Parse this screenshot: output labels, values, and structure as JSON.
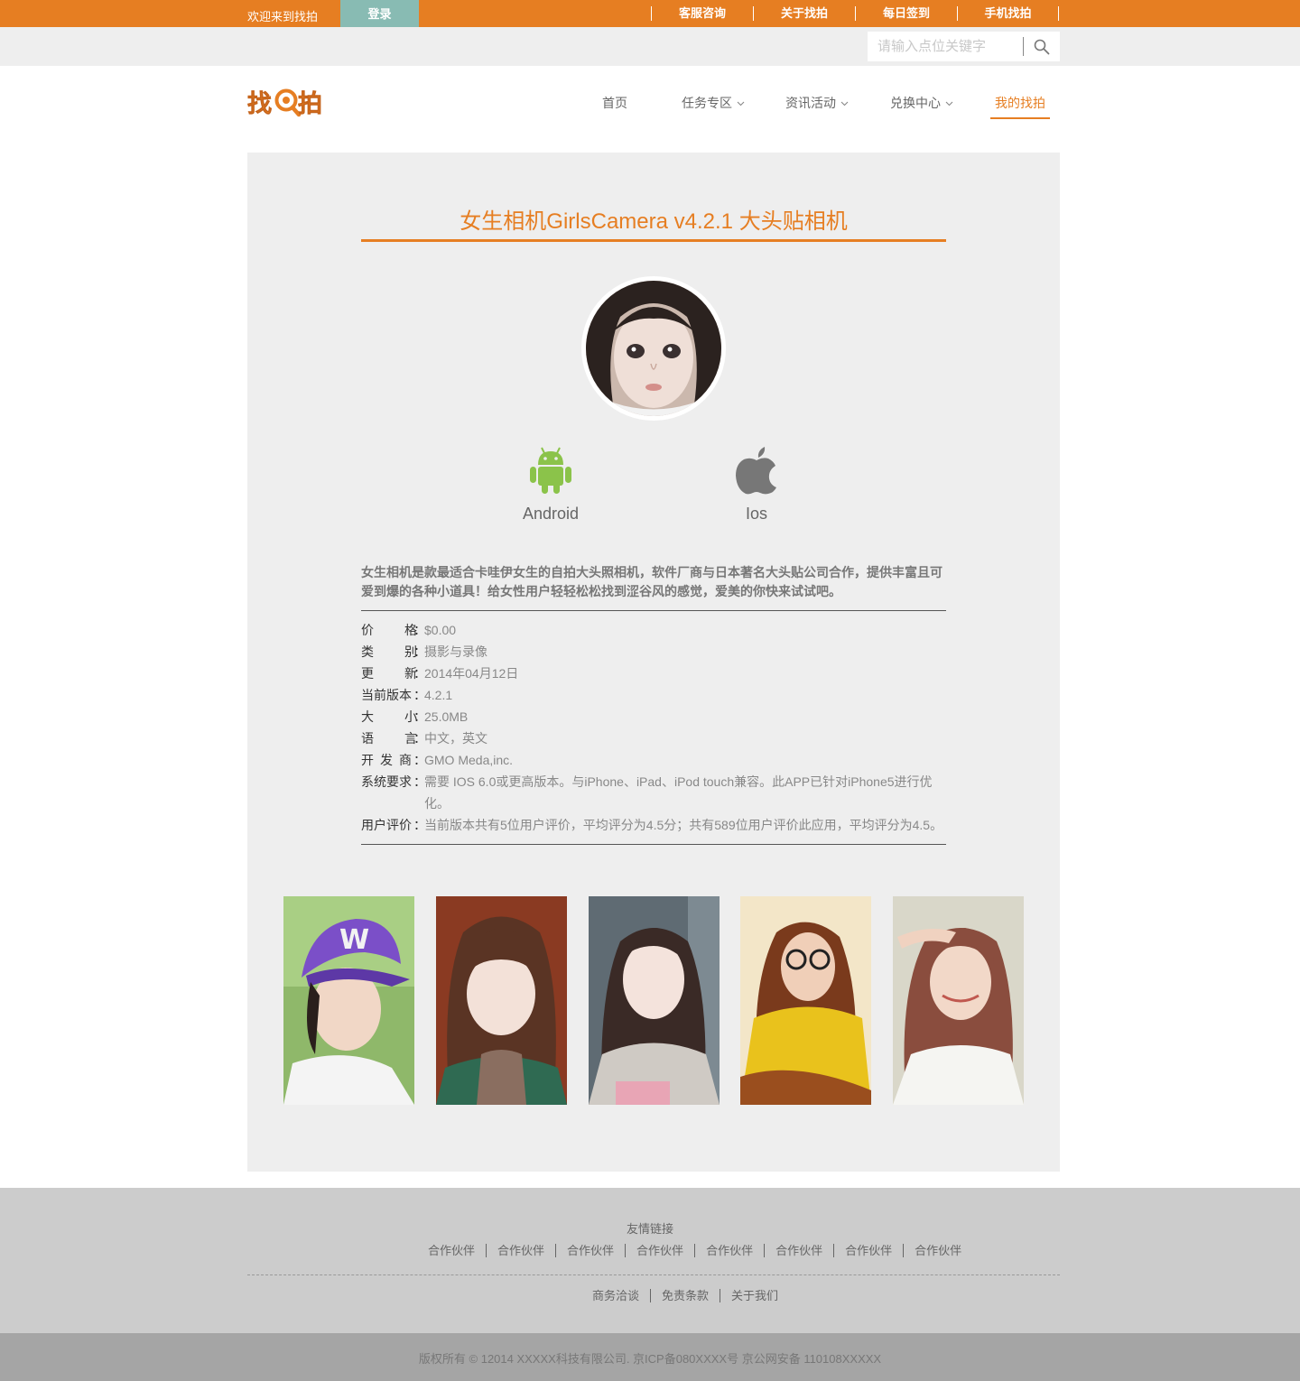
{
  "topbar": {
    "welcome": "欢迎来到找拍",
    "login": "登录",
    "links": [
      "客服咨询",
      "关于找拍",
      "每日签到",
      "手机找拍"
    ]
  },
  "search": {
    "placeholder": "请输入点位关键字",
    "icon": "search-icon"
  },
  "logo": {
    "text": "找拍",
    "accent": "#e67e22"
  },
  "nav": {
    "home": "首页",
    "tasks": "任务专区",
    "news": "资讯活动",
    "exchange": "兑换中心",
    "mine": "我的找拍"
  },
  "app": {
    "title": "女生相机GirlsCamera v4.2.1 大头贴相机",
    "platforms": {
      "android": "Android",
      "ios": "Ios"
    },
    "description": "女生相机是款最适合卡哇伊女生的自拍大头照相机，软件厂商与日本著名大头贴公司合作，提供丰富且可爱到爆的各种小道具！给女性用户轻轻松松找到涩谷风的感觉，爱美的你快来试试吧。",
    "info": {
      "price": {
        "key": [
          "价",
          "格"
        ],
        "value": "$0.00"
      },
      "category": {
        "key": [
          "类",
          "别"
        ],
        "value": "摄影与录像"
      },
      "updated": {
        "key": [
          "更",
          "新"
        ],
        "value": "2014年04月12日"
      },
      "version": {
        "key": "当前版本",
        "value": "4.2.1"
      },
      "size": {
        "key": [
          "大",
          "小"
        ],
        "value": "25.0MB"
      },
      "language": {
        "key": [
          "语",
          "言"
        ],
        "value": "中文，英文"
      },
      "developer": {
        "key": [
          "开",
          "发",
          "商"
        ],
        "value": "GMO Meda,inc."
      },
      "requirements": {
        "key": "系统要求",
        "value": "需要 IOS 6.0或更高版本。与iPhone、iPad、iPod touch兼容。此APP已针对iPhone5进行优化。"
      },
      "rating": {
        "key": "用户评价",
        "value": "当前版本共有5位用户评价，平均评分为4.5分；共有589位用户评价此应用，平均评分为4.5。"
      }
    },
    "colon": "："
  },
  "footer": {
    "friend_title": "友情链接",
    "partners": [
      "合作伙伴",
      "合作伙伴",
      "合作伙伴",
      "合作伙伴",
      "合作伙伴",
      "合作伙伴",
      "合作伙伴",
      "合作伙伴"
    ],
    "links": [
      "商务洽谈",
      "免责条款",
      "关于我们"
    ],
    "copyright": "版权所有 © 12014 XXXXX科技有限公司. 京ICP备080XXXX号 京公网安备 110108XXXXX"
  },
  "colors": {
    "brand": "#e67e22",
    "login": "#88bbb3",
    "android": "#8bc34a",
    "panel": "#eeeeee"
  }
}
